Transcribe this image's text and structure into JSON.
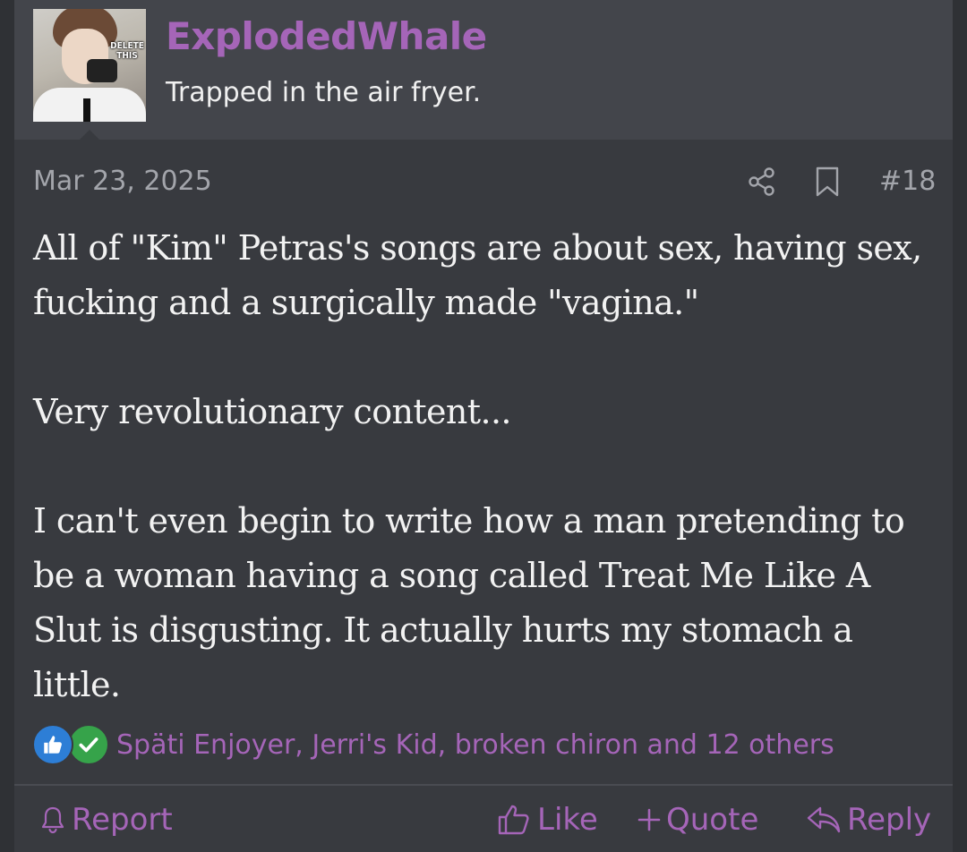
{
  "user": {
    "username": "ExplodedWhale",
    "title": "Trapped in the air fryer.",
    "avatar_caption": "DELETE THIS"
  },
  "post": {
    "date": "Mar 23, 2025",
    "number": "#18",
    "paragraphs": [
      "All of \"Kim\" Petras's songs are about sex, having sex, fucking and a surgically made \"vagina.\"",
      "Very revolutionary content...",
      "I can't even begin to write how a man pretending to be a woman having a song called Treat Me Like A Slut is disgusting. It actually hurts my stomach a little."
    ]
  },
  "reactions": {
    "summary": "Späti Enjoyer, Jerri's Kid, broken chiron and 12 others",
    "icons": [
      "thumbs-up-icon",
      "checkmark-icon"
    ]
  },
  "actions": {
    "report": "Report",
    "like": "Like",
    "quote": "Quote",
    "reply": "Reply"
  },
  "colors": {
    "accent": "#a565b8",
    "background": "#2f3135",
    "post_background": "#383a3f",
    "header_background": "#43454b",
    "muted_text": "#a3a5ab",
    "like_blue": "#2d7ed6",
    "check_green": "#36a34a"
  }
}
